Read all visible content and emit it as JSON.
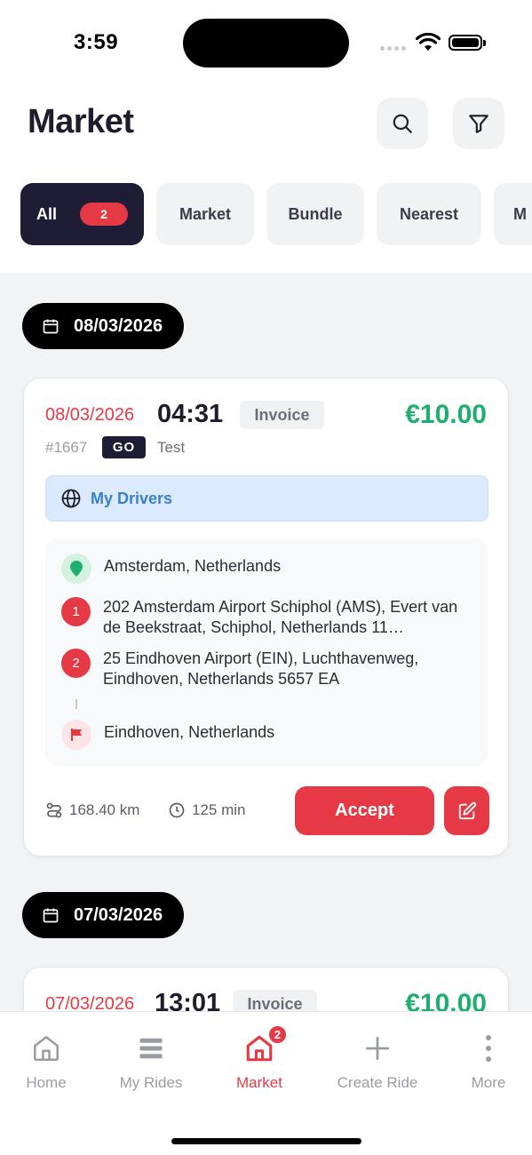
{
  "status_bar": {
    "time": "3:59"
  },
  "header": {
    "title": "Market"
  },
  "filters": [
    {
      "label": "All",
      "badge": "2",
      "active": true
    },
    {
      "label": "Market"
    },
    {
      "label": "Bundle"
    },
    {
      "label": "Nearest"
    },
    {
      "label": "M"
    }
  ],
  "groups": [
    {
      "date": "08/03/2026",
      "ride": {
        "date": "08/03/2026",
        "time": "04:31",
        "tag": "Invoice",
        "price": "€10.00",
        "id": "#1667",
        "type": "GO",
        "note": "Test",
        "visibility": "My Drivers",
        "pickup": "Amsterdam, Netherlands",
        "stops": [
          {
            "number": "1",
            "address": "202 Amsterdam Airport Schiphol (AMS), Evert van de Beekstraat, Schiphol, Netherlands 11…"
          },
          {
            "number": "2",
            "address": "25 Eindhoven Airport (EIN), Luchthavenweg, Eindhoven, Netherlands 5657 EA"
          }
        ],
        "dropoff": "Eindhoven, Netherlands",
        "distance": "168.40 km",
        "duration": "125 min",
        "accept_label": "Accept"
      }
    },
    {
      "date": "07/03/2026",
      "ride": {
        "date": "07/03/2026",
        "time": "13:01",
        "tag": "Invoice",
        "price": "€10.00"
      }
    }
  ],
  "tab_bar": [
    {
      "label": "Home",
      "icon": "home-icon"
    },
    {
      "label": "My Rides",
      "icon": "list-icon"
    },
    {
      "label": "Market",
      "icon": "market-icon",
      "badge": "2",
      "active": true
    },
    {
      "label": "Create Ride",
      "icon": "plus-icon"
    },
    {
      "label": "More",
      "icon": "more-icon"
    }
  ],
  "colors": {
    "accent": "#e63946",
    "dark": "#1e1d35",
    "price": "#1eae6f",
    "link": "#3b7fd0"
  }
}
